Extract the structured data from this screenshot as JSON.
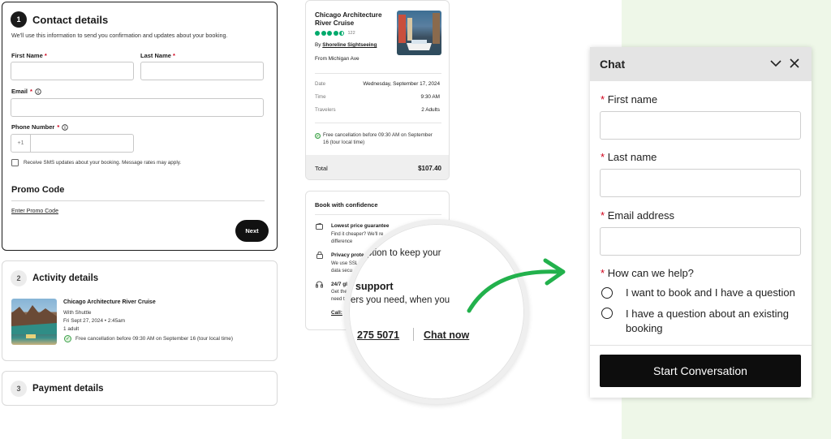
{
  "contact": {
    "step": "1",
    "title": "Contact details",
    "subtitle": "We'll use this information to send you confirmation and updates about your booking.",
    "first_name_label": "First Name",
    "last_name_label": "Last Name",
    "email_label": "Email",
    "phone_label": "Phone Number",
    "phone_prefix": "+1",
    "sms_label": "Receive SMS updates about your booking. Message rates may apply.",
    "promo_title": "Promo Code",
    "promo_link": "Enter Promo Code",
    "next_label": "Next",
    "required_mark": "*",
    "info_icon": "info-icon"
  },
  "activity": {
    "step": "2",
    "title": "Activity details",
    "name": "Chicago Architecture River Cruise",
    "option": "With Shuttle",
    "datetime": "Fri Sept 27, 2024 • 2:45am",
    "guests": "1 adult",
    "cancellation": "Free cancellation before 09:30 AM on September 16 (tour local time)"
  },
  "payment": {
    "step": "3",
    "title": "Payment details"
  },
  "summary": {
    "title_line1": "Chicago Architecture",
    "title_line2": "River Cruise",
    "rating_count": "122",
    "rating_value": 4.5,
    "by_prefix": "By",
    "operator": "Shoreline Sightseeing",
    "departure": "From Michigan Ave",
    "date_label": "Date",
    "date_value": "Wednesday, September 17, 2024",
    "time_label": "Time",
    "time_value": "9:30 AM",
    "travelers_label": "Travelers",
    "travelers_value": "2 Adults",
    "cancellation": "Free cancellation before 09:30 AM on September 16 (tour local time)",
    "total_label": "Total",
    "total_value": "$107.40"
  },
  "confidence": {
    "title": "Book with confidence",
    "item1_title": "Lowest price guarantee",
    "item1_text_a": "Find it cheaper? We'll re",
    "item1_text_b": "difference",
    "item2_title": "Privacy prote",
    "item2_text_a": "We use SSL",
    "item2_text_b": "data secu",
    "item3_title": "24/7 gl",
    "item3_text_a": "Get the",
    "item3_text_b": "need t",
    "item3_link": "Call:"
  },
  "magnifier": {
    "line1": "ption to keep your",
    "heading": "support",
    "line2": "ers you need, when you",
    "phone": "275 5071",
    "chat_link": "Chat now"
  },
  "chat": {
    "title": "Chat",
    "first_name": "First name",
    "last_name": "Last name",
    "email": "Email address",
    "help": "How can we help?",
    "option1": "I want to book and I have a question",
    "option2_line1": "I have a question about an existing",
    "option2_line2": "booking",
    "button": "Start Conversation",
    "required_mark": "*"
  },
  "colors": {
    "accent_green": "#22b14c",
    "required_red": "#d0021b",
    "dark": "#111111",
    "panel_bg": "#eef7e8",
    "rating_green": "#00aa6c"
  }
}
